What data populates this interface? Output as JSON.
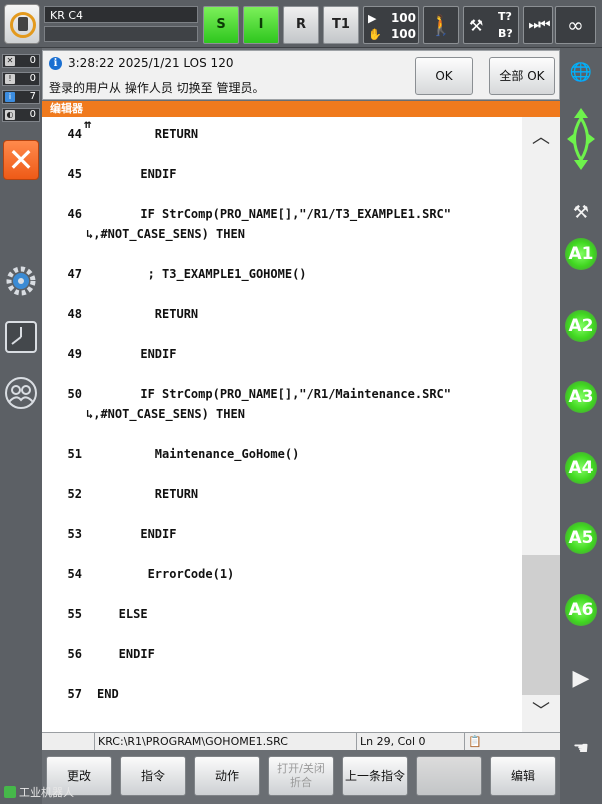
{
  "header": {
    "robot_name": "KR C4",
    "btn_s": "S",
    "btn_i": "I",
    "btn_r": "R",
    "btn_mode": "T1",
    "program_override": "100",
    "jog_override": "100",
    "tool_base_top": "T?",
    "tool_base_bottom": "B?",
    "infinity": "∞"
  },
  "counters": [
    {
      "icon": "acknowledge",
      "value": "0"
    },
    {
      "icon": "status",
      "value": "0"
    },
    {
      "icon": "info",
      "value": "7"
    },
    {
      "icon": "wait",
      "value": "0"
    }
  ],
  "message": {
    "time_line": "3:28:22 2025/1/21 LOS 120",
    "text": "登录的用户从 操作人员 切换至 管理员。",
    "ok_label": "OK",
    "all_ok_label": "全部 OK"
  },
  "editor": {
    "title": "编辑器",
    "cursor_mark": "⇈",
    "lines": [
      {
        "num": "44",
        "text": "        RETURN"
      },
      {
        "num": "45",
        "text": "      ENDIF"
      },
      {
        "num": "46",
        "text": "      IF StrComp(PRO_NAME[],\"/R1/T3_EXAMPLE1.SRC\""
      },
      {
        "num": "",
        "text": "↳,#NOT_CASE_SENS) THEN"
      },
      {
        "num": "47",
        "text": "       ; T3_EXAMPLE1_GOHOME()"
      },
      {
        "num": "48",
        "text": "        RETURN"
      },
      {
        "num": "49",
        "text": "      ENDIF"
      },
      {
        "num": "50",
        "text": "      IF StrComp(PRO_NAME[],\"/R1/Maintenance.SRC\""
      },
      {
        "num": "",
        "text": "↳,#NOT_CASE_SENS) THEN"
      },
      {
        "num": "51",
        "text": "        Maintenance_GoHome()"
      },
      {
        "num": "52",
        "text": "        RETURN"
      },
      {
        "num": "53",
        "text": "      ENDIF"
      },
      {
        "num": "54",
        "text": "       ErrorCode(1)"
      },
      {
        "num": "55",
        "text": "   ELSE"
      },
      {
        "num": "56",
        "text": "   ENDIF"
      },
      {
        "num": "57",
        "text": "END"
      }
    ]
  },
  "status": {
    "path": "KRC:\\R1\\PROGRAM\\GOHOME1.SRC",
    "position": "Ln 29, Col 0"
  },
  "softkeys": {
    "change": "更改",
    "instruction": "指令",
    "motion": "动作",
    "fold_line1": "打开/关闭",
    "fold_line2": "折合",
    "last_instruction": "上一条指令",
    "edit": "编辑"
  },
  "axes": [
    "A1",
    "A2",
    "A3",
    "A4",
    "A5",
    "A6"
  ],
  "watermark": "工业机器人"
}
